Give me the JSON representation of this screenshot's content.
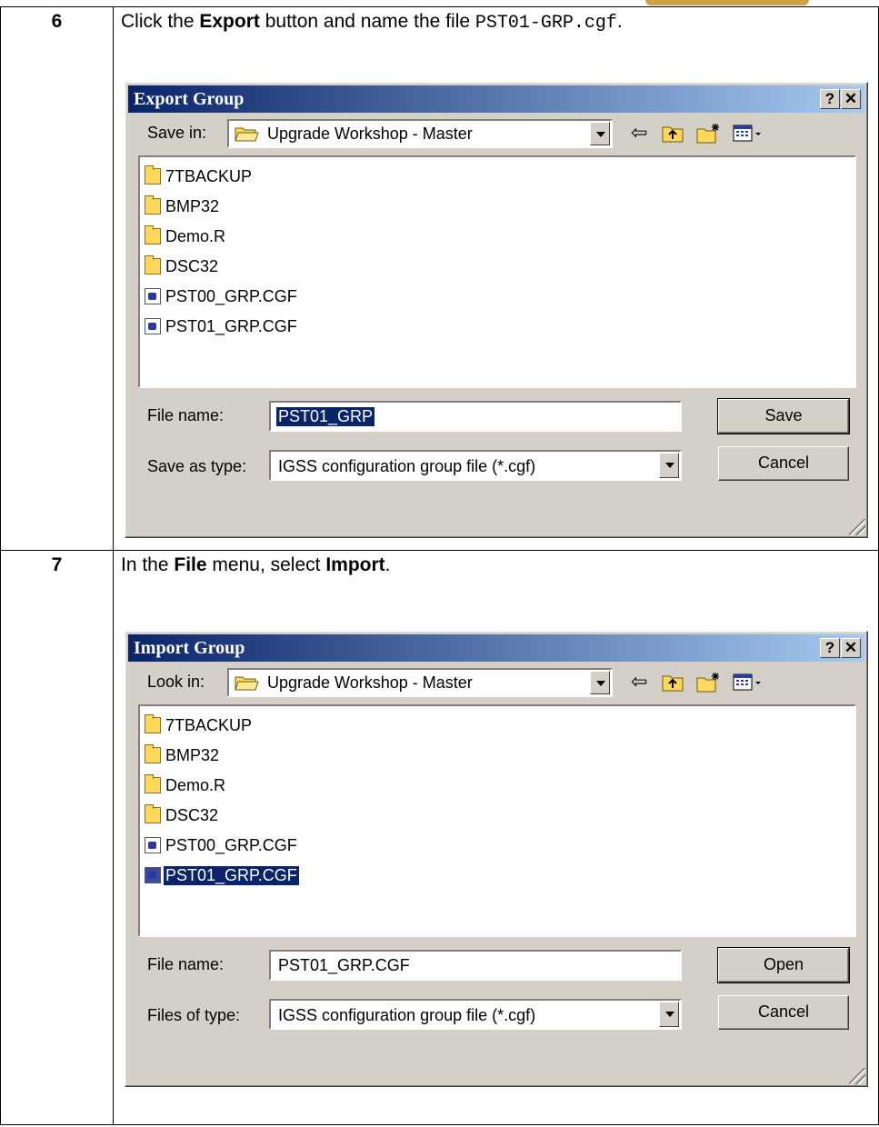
{
  "steps": [
    {
      "number": "6",
      "instruction": {
        "pre": "Click the ",
        "bold1": "Export",
        "mid": " button and name the file ",
        "code": "PST01-GRP.cgf",
        "post": "."
      },
      "dialog": {
        "title": "Export Group",
        "location_label": "Save in:",
        "location_value": "Upgrade Workshop - Master",
        "files": [
          {
            "name": "7TBACKUP",
            "type": "folder"
          },
          {
            "name": "BMP32",
            "type": "folder"
          },
          {
            "name": "Demo.R",
            "type": "folder"
          },
          {
            "name": "DSC32",
            "type": "folder"
          },
          {
            "name": "PST00_GRP.CGF",
            "type": "file"
          },
          {
            "name": "PST01_GRP.CGF",
            "type": "file"
          }
        ],
        "filename_label": "File name:",
        "filename_value": "PST01_GRP",
        "filetype_label": "Save as type:",
        "filetype_value": "IGSS configuration group file (*.cgf)",
        "primary_button": "Save",
        "cancel_button": "Cancel"
      }
    },
    {
      "number": "7",
      "instruction": {
        "pre": "In the ",
        "bold1": "File",
        "mid": " menu, select ",
        "bold2": "Import",
        "post": "."
      },
      "dialog": {
        "title": "Import Group",
        "location_label": "Look in:",
        "location_value": "Upgrade Workshop - Master",
        "files": [
          {
            "name": "7TBACKUP",
            "type": "folder"
          },
          {
            "name": "BMP32",
            "type": "folder"
          },
          {
            "name": "Demo.R",
            "type": "folder"
          },
          {
            "name": "DSC32",
            "type": "folder"
          },
          {
            "name": "PST00_GRP.CGF",
            "type": "file"
          },
          {
            "name": "PST01_GRP.CGF",
            "type": "file",
            "selected": true
          }
        ],
        "filename_label": "File name:",
        "filename_value": "PST01_GRP.CGF",
        "filetype_label": "Files of type:",
        "filetype_value": "IGSS configuration group file (*.cgf)",
        "primary_button": "Open",
        "cancel_button": "Cancel"
      }
    }
  ],
  "titlebar_buttons": {
    "help": "?",
    "close": "✕"
  },
  "toolbar_icons": [
    "back-arrow-icon",
    "up-folder-icon",
    "new-folder-icon",
    "view-menu-icon"
  ],
  "colors": {
    "titlebar_start": "#0a246a",
    "titlebar_end": "#a6caf0",
    "dialog_bg": "#d4d0c8",
    "selection": "#0a246a"
  }
}
